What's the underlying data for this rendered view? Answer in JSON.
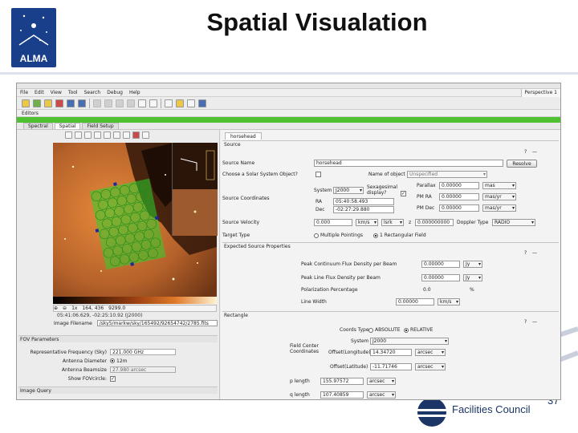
{
  "slide": {
    "title": "Spatial Visualation",
    "logo_text": "ALMA",
    "footer_text": "Facilities Council",
    "slide_number": "37"
  },
  "app": {
    "menu": [
      "File",
      "Edit",
      "View",
      "Tool",
      "Search",
      "Debug",
      "Help"
    ],
    "perspective": "Perspective 1",
    "editors_label": "Editors",
    "tabs": [
      "Spectral",
      "Spatial",
      "Field Setup"
    ],
    "active_tab": "Spatial",
    "image_status": {
      "scale": "1x",
      "pixel": "164, 436",
      "value": "9299.0",
      "coords": "05:41:06.629, -02:25:10.92 (J2000)"
    },
    "image_filename_label": "Image Filename",
    "image_filename": "/sky5/markw/sky/165492/92654742/2785.fits",
    "fov": {
      "header": "FOV Parameters",
      "rep_freq_label": "Representative Frequency (Sky)",
      "rep_freq_value": "221.000 GHz",
      "antenna_label": "Antenna Diameter",
      "antenna_value": "12m",
      "beamsize_label": "Antenna Beamsize",
      "beamsize_value": "27.980 arcsec",
      "show_fov_label": "Show FOVcircle:"
    },
    "image_query_label": "Image Query",
    "right": {
      "tab": "horsehead",
      "source_section": "Source",
      "source_name_label": "Source Name",
      "source_name_value": "horsehead",
      "resolve_label": "Resolve",
      "solar_label": "Choose a Solar System Object?",
      "name_of_object_label": "Name of object",
      "name_of_object_value": "Unspecified",
      "system_label": "System",
      "system_value": "J2000",
      "sexagesimal_label": "Sexagesimal display?",
      "coords_label": "Source Coordinates",
      "ra_label": "RA",
      "ra_value": "05:40:58.493",
      "dec_label": "Dec",
      "dec_value": "-02:27:29.880",
      "parallax_label": "Parallax",
      "parallax_value": "0.00000",
      "parallax_unit": "mas",
      "pmra_label": "PM RA",
      "pmra_value": "0.00000",
      "pmra_unit": "mas/yr",
      "pmdec_label": "PM Dec",
      "pmdec_value": "0.00000",
      "pmdec_unit": "mas/yr",
      "velocity_label": "Source Velocity",
      "velocity_value": "0.000",
      "velocity_unit": "km/s",
      "frame_value": "lsrk",
      "z_label": "z",
      "z_value": "0.000000000",
      "doppler_label": "Doppler Type",
      "doppler_value": "RADIO",
      "target_label": "Target Type",
      "target_opt1": "Multiple Pointings",
      "target_opt2": "1 Rectangular Field",
      "expected_section": "Expected Source Properties",
      "peak_cont_label": "Peak Continuum Flux Density per Beam",
      "peak_cont_value": "0.00000",
      "peak_cont_unit": "Jy",
      "peak_line_label": "Peak Line Flux Density per Beam",
      "peak_line_value": "0.00000",
      "peak_line_unit": "Jy",
      "polar_label": "Polarization Percentage",
      "polar_value": "0.0",
      "polar_unit": "%",
      "linewidth_label": "Line Width",
      "linewidth_value": "0.00000",
      "linewidth_unit": "km/s",
      "rect_section": "Rectangle",
      "coords_type_label": "Coords Type",
      "coords_type_opt1": "ABSOLUTE",
      "coords_type_opt2": "RELATIVE",
      "rsystem_label": "System",
      "rsystem_value": "J2000",
      "field_center_label": "Field Center Coordinates",
      "offset_long_label": "Offset(Longitude)",
      "offset_long_value": "14.34720",
      "offset_long_unit": "arcsec",
      "offset_lat_label": "Offset(Latitude)",
      "offset_lat_value": "-11.71746",
      "offset_lat_unit": "arcsec",
      "plength_label": "p length",
      "plength_value": "155.97572",
      "plength_unit": "arcsec",
      "qlength_label": "q length",
      "qlength_value": "107.40859",
      "qlength_unit": "arcsec"
    }
  },
  "colors": {
    "accent_green": "#4fc02f",
    "pointing_green": "#2cd12c",
    "logo_blue": "#1a3f8a"
  }
}
